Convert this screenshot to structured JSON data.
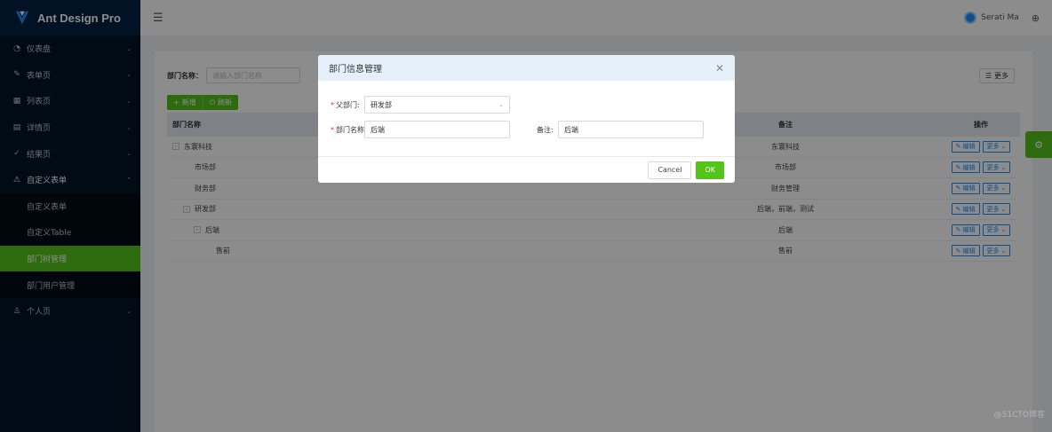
{
  "app": {
    "title": "Ant Design Pro"
  },
  "sidebar": {
    "items": [
      {
        "label": "仪表盘",
        "icon": "dashboard-icon"
      },
      {
        "label": "表单页",
        "icon": "form-icon"
      },
      {
        "label": "列表页",
        "icon": "table-icon"
      },
      {
        "label": "详情页",
        "icon": "profile-icon"
      },
      {
        "label": "结果页",
        "icon": "check-circle-icon"
      },
      {
        "label": "自定义表单",
        "icon": "warning-icon"
      }
    ],
    "subitems": [
      {
        "label": "自定义表单"
      },
      {
        "label": "自定义Table"
      },
      {
        "label": "部门树管理"
      },
      {
        "label": "部门用户管理"
      }
    ],
    "last_item": {
      "label": "个人页",
      "icon": "user-icon"
    }
  },
  "header": {
    "user_name": "Serati Ma"
  },
  "search": {
    "label": "部门名称：",
    "placeholder": "请输入部门名称",
    "more_label": "更多"
  },
  "toolbar": {
    "add_label": "新增",
    "refresh_label": "刷新"
  },
  "table": {
    "headers": {
      "name": "部门名称",
      "remark": "备注",
      "op": "操作"
    },
    "rows": [
      {
        "name": "东寰科技",
        "remark": "东寰科技",
        "expand": "-"
      },
      {
        "name": "市场部",
        "remark": "市场部",
        "expand": ""
      },
      {
        "name": "财务部",
        "remark": "财务管理",
        "expand": ""
      },
      {
        "name": "研发部",
        "remark": "后端，前端，测试",
        "expand": "-"
      },
      {
        "name": "后端",
        "remark": "后端",
        "expand": "-"
      },
      {
        "name": "售前",
        "remark": "售前",
        "expand": ""
      }
    ],
    "edit_label": "编辑",
    "more_label": "更多"
  },
  "modal": {
    "title": "部门信息管理",
    "parent_label": "父部门:",
    "parent_value": "研发部",
    "name_label": "部门名称",
    "name_value": "后端",
    "remark_label": "备注:",
    "remark_value": "后端",
    "cancel_label": "Cancel",
    "ok_label": "OK"
  },
  "watermark": "@51CTO博客",
  "colors": {
    "primary": "#52c41a",
    "sidebar": "#001529",
    "link": "#1890ff"
  }
}
